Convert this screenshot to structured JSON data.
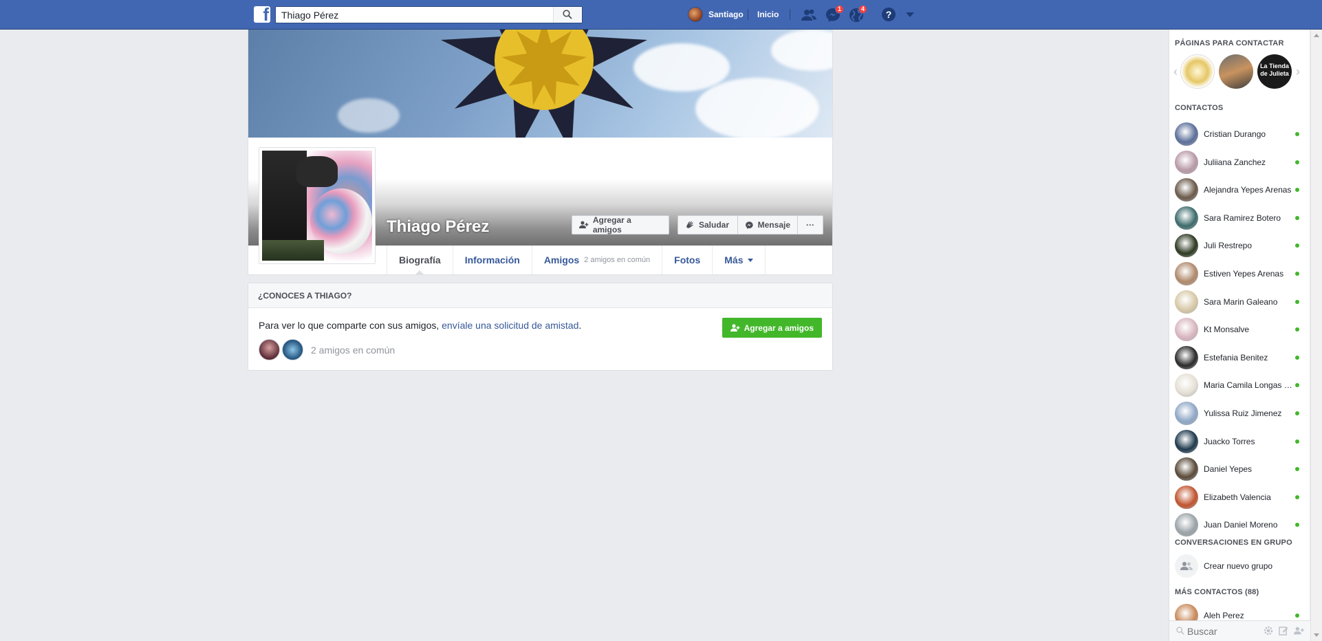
{
  "topbar": {
    "search_value": "Thiago Pérez",
    "user_name": "Santiago",
    "home_label": "Inicio",
    "messages_badge": "1",
    "notifications_badge": "4",
    "help_label": "?"
  },
  "profile": {
    "name": "Thiago Pérez",
    "add_friend_label": "Agregar a amigos",
    "greet_label": "Saludar",
    "message_label": "Mensaje",
    "more_label": "···",
    "tabs": [
      {
        "label": "Biografía"
      },
      {
        "label": "Información"
      },
      {
        "label": "Amigos",
        "sub": "2 amigos en común"
      },
      {
        "label": "Fotos"
      },
      {
        "label": "Más"
      }
    ]
  },
  "know_card": {
    "heading": "¿CONOCES A THIAGO?",
    "text_prefix": "Para ver lo que comparte con sus amigos, ",
    "link_text": "envíale una solicitud de amistad",
    "text_suffix": ".",
    "mutual_text": "2 amigos en común",
    "button_label": "Agregar a amigos"
  },
  "sidebar": {
    "pages_heading": "PÁGINAS PARA CONTACTAR",
    "page3_text": "La Tienda de Julieta",
    "contacts_heading": "CONTACTOS",
    "contacts": [
      {
        "name": "Cristian Durango",
        "color": "#5b6f9a"
      },
      {
        "name": "Juliiana Zanchez",
        "color": "#b89aa6"
      },
      {
        "name": "Alejandra Yepes Arenas",
        "color": "#6a5a4a"
      },
      {
        "name": "Sara Ramirez Botero",
        "color": "#3d6b6b"
      },
      {
        "name": "Juli Restrepo",
        "color": "#2e3a22"
      },
      {
        "name": "Estiven Yepes Arenas",
        "color": "#b0896b"
      },
      {
        "name": "Sara Marin Galeano",
        "color": "#d7c9a8"
      },
      {
        "name": "Kt Monsalve",
        "color": "#d8b6c0"
      },
      {
        "name": "Estefania Benitez",
        "color": "#2b2b2b"
      },
      {
        "name": "Maria Camila Longas Benitez",
        "color": "#e5e0d5"
      },
      {
        "name": "Yulissa Ruiz Jimenez",
        "color": "#8fa7c6"
      },
      {
        "name": "Juacko Torres",
        "color": "#1f3a4d"
      },
      {
        "name": "Daniel Yepes",
        "color": "#5a4a3a"
      },
      {
        "name": "Elizabeth Valencia",
        "color": "#c0542f"
      },
      {
        "name": "Juan Daniel Moreno",
        "color": "#9aa3a8"
      }
    ],
    "groups_heading": "CONVERSACIONES EN GRUPO",
    "create_group_label": "Crear nuevo grupo",
    "more_contacts_heading": "MÁS CONTACTOS (88)",
    "more_contacts": [
      {
        "name": "Aleh Perez",
        "color": "#c98a5a"
      }
    ],
    "search_placeholder": "Buscar"
  },
  "colors": {
    "brand": "#4267b2",
    "link": "#365899",
    "online": "#42b72a"
  }
}
